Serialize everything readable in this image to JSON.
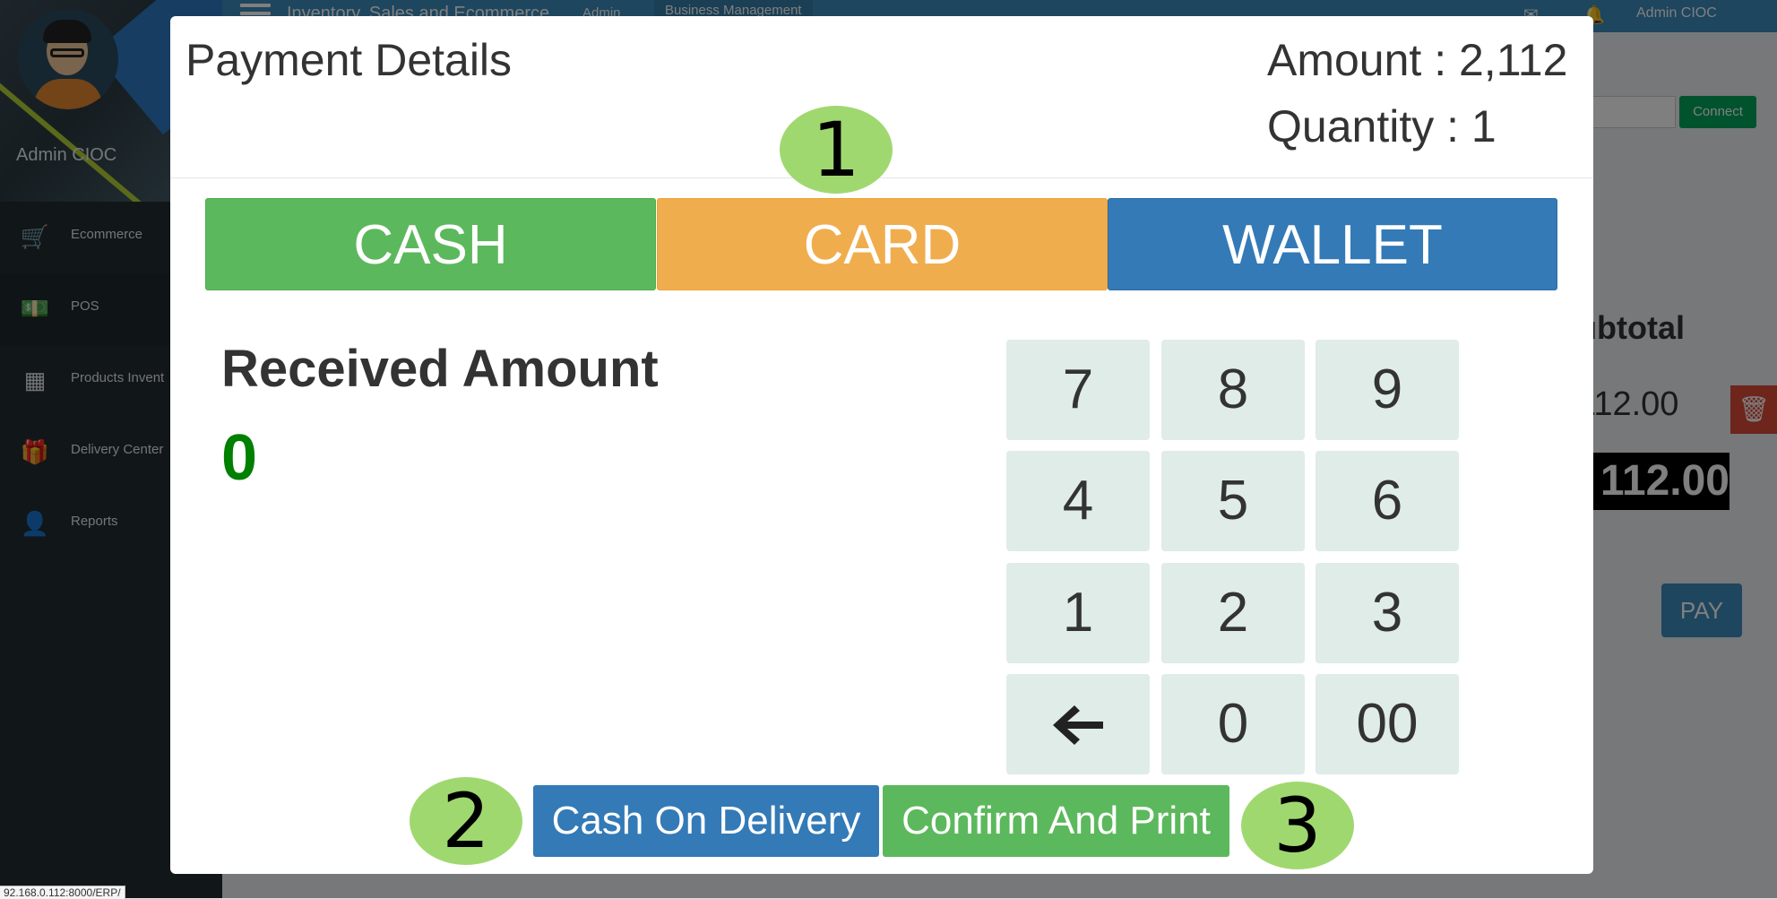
{
  "app": {
    "title": "Inventory, Sales and Ecommerce",
    "top_links": [
      "Admin",
      "Business Management"
    ],
    "user": "Admin CIOC"
  },
  "sidebar": {
    "user_name": "Admin CIOC",
    "items": [
      {
        "label": "Ecommerce",
        "icon": "cart-icon"
      },
      {
        "label": "POS",
        "icon": "money-icon"
      },
      {
        "label": "Products Invent",
        "icon": "cubes-icon"
      },
      {
        "label": "Delivery Center",
        "icon": "gift-icon"
      },
      {
        "label": "Reports",
        "icon": "user-icon"
      }
    ]
  },
  "background": {
    "connect_label": "Connect",
    "subtotal_header": "ubtotal",
    "subtotal_value": "112.00",
    "total_value": "112.00",
    "pay_label": "PAY",
    "status_url": "92.168.0.112:8000/ERP/"
  },
  "modal": {
    "title": "Payment Details",
    "amount_label": "Amount : 2,112",
    "quantity_label": "Quantity : 1",
    "methods": [
      {
        "label": "CASH",
        "color": "#5cb85c"
      },
      {
        "label": "CARD",
        "color": "#f0ad4e"
      },
      {
        "label": "WALLET",
        "color": "#337ab7"
      }
    ],
    "received_label": "Received Amount",
    "received_value": "0",
    "keypad": [
      [
        "7",
        "8",
        "9"
      ],
      [
        "4",
        "5",
        "6"
      ],
      [
        "1",
        "2",
        "3"
      ],
      [
        "backspace",
        "0",
        "00"
      ]
    ],
    "actions": {
      "cash_on_delivery": "Cash On Delivery",
      "confirm_print": "Confirm And Print"
    },
    "markers": [
      "1",
      "2",
      "3"
    ]
  },
  "colors": {
    "accent_blue": "#337ab7",
    "success_green": "#5cb85c",
    "warning_orange": "#f0ad4e",
    "received_green": "#008000",
    "marker_green": "#a0d870"
  }
}
